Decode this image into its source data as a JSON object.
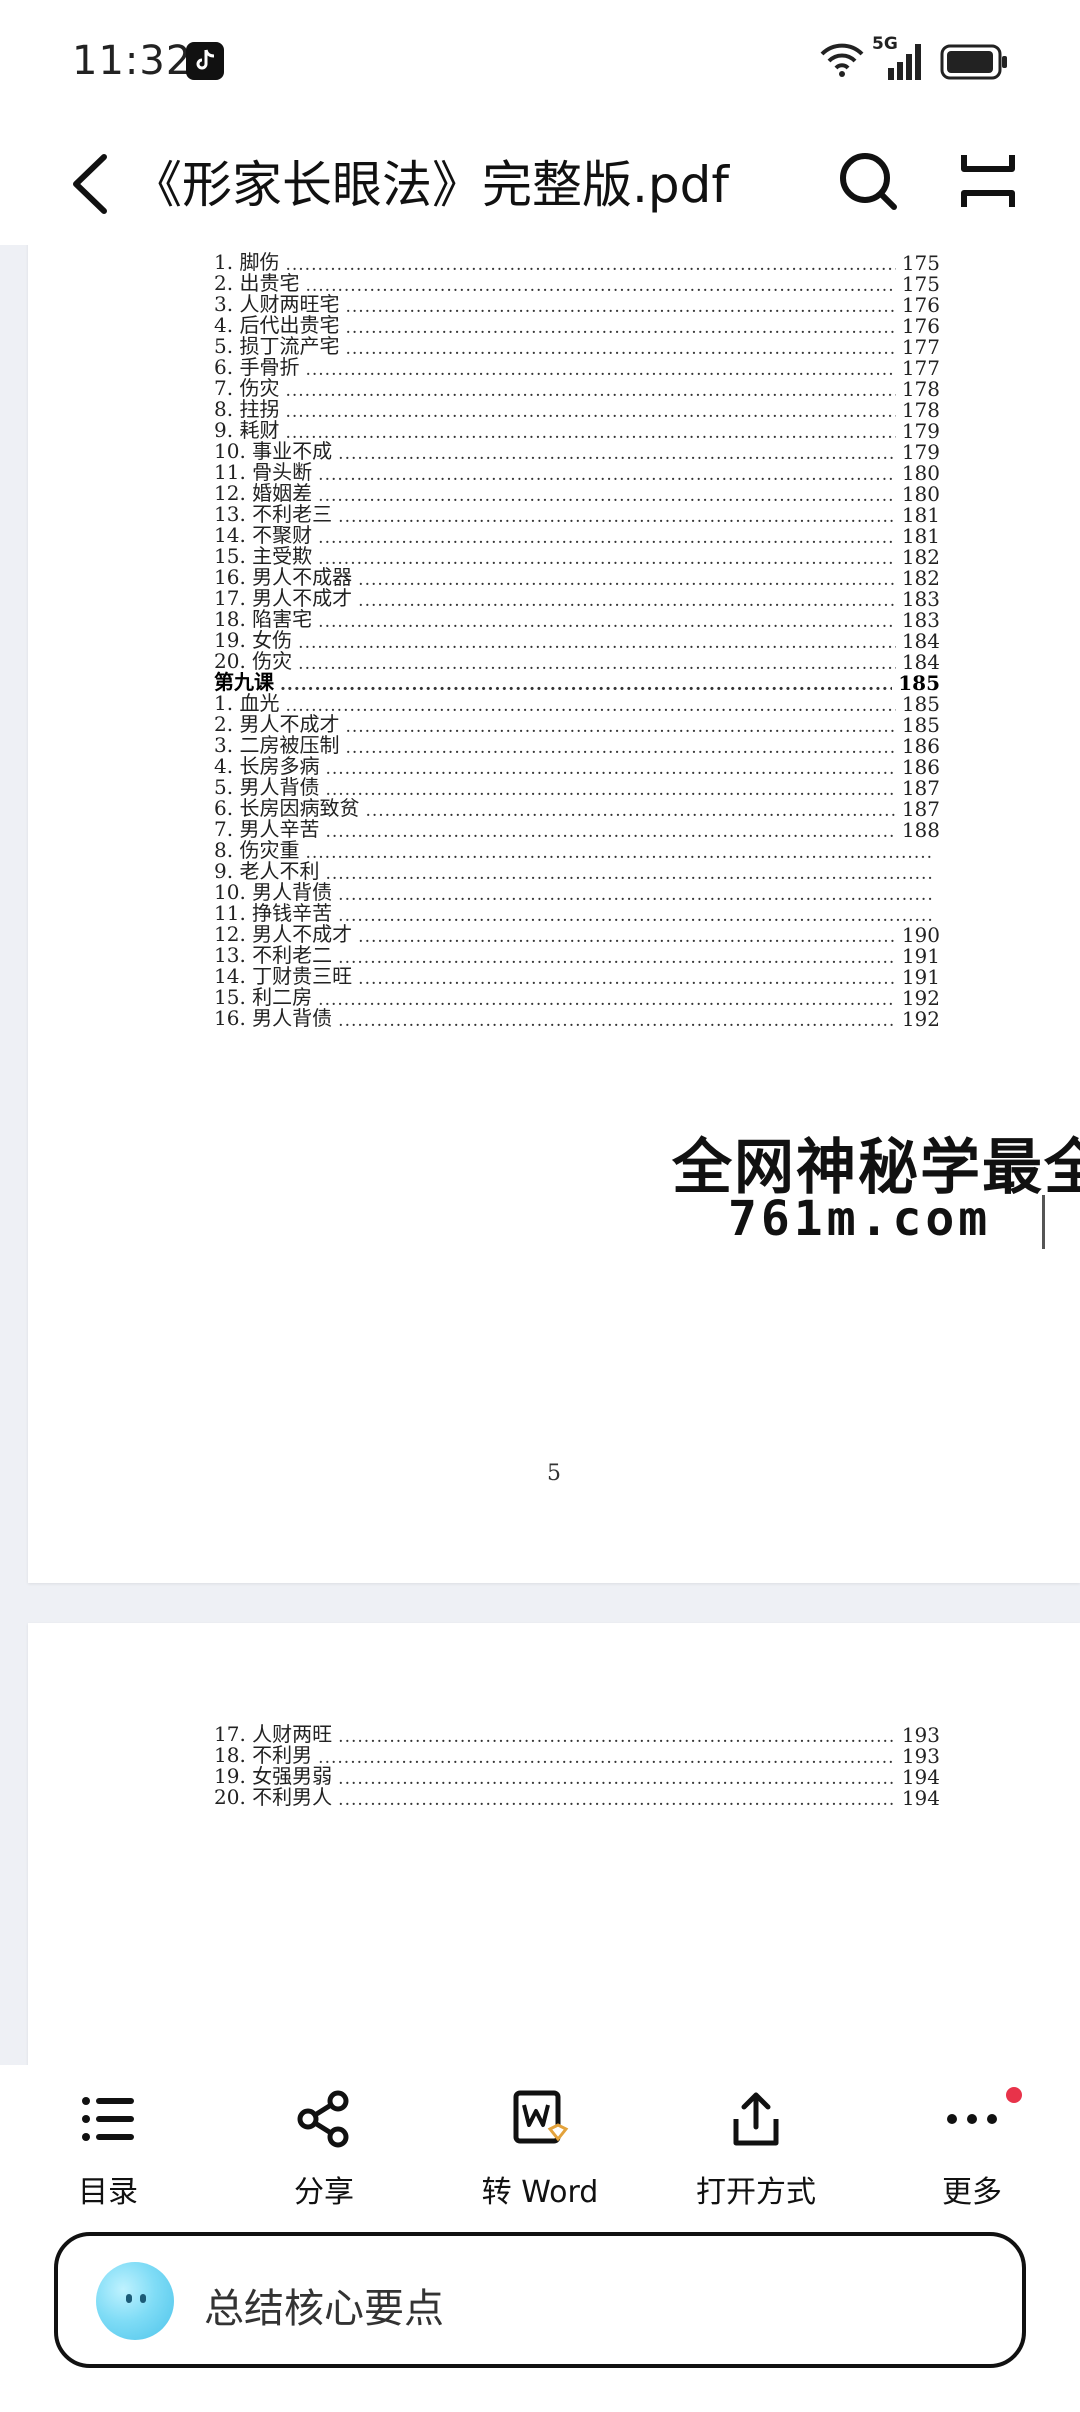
{
  "status_bar": {
    "time": "11:32",
    "network": "5G",
    "app_icon": "tiktok-icon",
    "icons": [
      "wifi-icon",
      "signal-icon",
      "battery-icon"
    ]
  },
  "header": {
    "title": "《形家长眼法》完整版.pdf",
    "back_icon": "back-arrow-icon",
    "search_icon": "search-icon",
    "fullscreen_icon": "fullscreen-icon"
  },
  "page_a": {
    "page_number": "5",
    "entries": [
      {
        "label": "1. 脚伤",
        "page": "175"
      },
      {
        "label": "2. 出贵宅",
        "page": "175"
      },
      {
        "label": "3. 人财两旺宅",
        "page": "176"
      },
      {
        "label": "4. 后代出贵宅",
        "page": "176"
      },
      {
        "label": "5. 损丁流产宅",
        "page": "177"
      },
      {
        "label": "6. 手骨折",
        "page": "177"
      },
      {
        "label": "7. 伤灾",
        "page": "178"
      },
      {
        "label": "8. 拄拐",
        "page": "178"
      },
      {
        "label": "9. 耗财",
        "page": "179"
      },
      {
        "label": "10. 事业不成",
        "page": "179"
      },
      {
        "label": "11. 骨头断",
        "page": "180"
      },
      {
        "label": "12. 婚姻差",
        "page": "180"
      },
      {
        "label": "13. 不利老三",
        "page": "181"
      },
      {
        "label": "14. 不聚财",
        "page": "181"
      },
      {
        "label": "15. 主受欺",
        "page": "182"
      },
      {
        "label": "16. 男人不成器",
        "page": "182"
      },
      {
        "label": "17. 男人不成才",
        "page": "183"
      },
      {
        "label": "18. 陷害宅",
        "page": "183"
      },
      {
        "label": "19. 女伤",
        "page": "184"
      },
      {
        "label": "20. 伤灾",
        "page": "184"
      },
      {
        "label": "第九课",
        "page": "185",
        "bold": true
      },
      {
        "label": "1. 血光",
        "page": "185"
      },
      {
        "label": "2. 男人不成才",
        "page": "185"
      },
      {
        "label": "3. 二房被压制",
        "page": "186"
      },
      {
        "label": "4. 长房多病",
        "page": "186"
      },
      {
        "label": "5. 男人背债",
        "page": "187"
      },
      {
        "label": "6. 长房因病致贫",
        "page": "187"
      },
      {
        "label": "7. 男人辛苦",
        "page": "188"
      },
      {
        "label": "8. 伤灾重",
        "page": ""
      },
      {
        "label": "9. 老人不利",
        "page": ""
      },
      {
        "label": "10. 男人背债",
        "page": ""
      },
      {
        "label": "11. 挣钱辛苦",
        "page": ""
      },
      {
        "label": "12. 男人不成才",
        "page": "190"
      },
      {
        "label": "13. 不利老二",
        "page": "191"
      },
      {
        "label": "14. 丁财贵三旺",
        "page": "191"
      },
      {
        "label": "15. 利二房",
        "page": "192"
      },
      {
        "label": "16. 男人背债",
        "page": "192"
      }
    ]
  },
  "page_b": {
    "entries": [
      {
        "label": "17. 人财两旺",
        "page": "193"
      },
      {
        "label": "18. 不利男",
        "page": "193"
      },
      {
        "label": "19. 女强男弱",
        "page": "194"
      },
      {
        "label": "20. 不利男人",
        "page": "194"
      }
    ]
  },
  "watermark": {
    "line1": "全网神秘学最全",
    "line2": "761m.com"
  },
  "toolbar": {
    "items": [
      {
        "label": "目录",
        "icon": "toc-list-icon"
      },
      {
        "label": "分享",
        "icon": "share-icon"
      },
      {
        "label": "转 Word",
        "icon": "convert-word-icon"
      },
      {
        "label": "打开方式",
        "icon": "open-with-icon"
      },
      {
        "label": "更多",
        "icon": "more-icon"
      }
    ],
    "badge_color": "#e8334a"
  },
  "ai_bar": {
    "text": "总结核心要点",
    "avatar_icon": "ai-assistant-icon"
  }
}
